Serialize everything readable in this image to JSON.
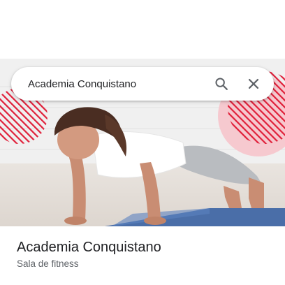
{
  "search": {
    "query": "Academia Conquistano"
  },
  "place": {
    "name": "Academia Conquistano",
    "category": "Sala de fitness"
  },
  "icons": {
    "search": "search-icon",
    "close": "close-icon"
  },
  "colors": {
    "accent_stripes": "#e0203a",
    "accent_blob": "#f6c9cf",
    "icon_gray": "#5f6368",
    "title_text": "#202124",
    "subtitle_text": "#5f6368"
  }
}
